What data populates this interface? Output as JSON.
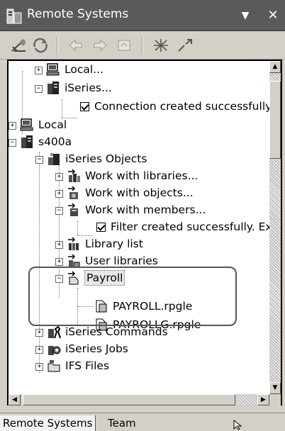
{
  "window": {
    "title": "Remote Systems"
  },
  "toolbar": {
    "buttons": [
      "new-connection-icon",
      "refresh-icon",
      "back-icon",
      "forward-icon",
      "home-icon",
      "collapse-all-icon",
      "link-with-editor-icon"
    ]
  },
  "tree": {
    "local1": "Local...",
    "iseries1": "iSeries...",
    "connection_msg": "Connection created successfully.",
    "local2": "Local",
    "s400a": "s400a",
    "iseries_objects": "iSeries Objects",
    "work_libraries": "Work with libraries...",
    "work_objects": "Work with objects...",
    "work_members": "Work with members...",
    "filter_msg": "Filter created successfully. Exp",
    "library_list": "Library list",
    "user_libraries": "User libraries",
    "payroll": "Payroll",
    "payroll_file": "PAYROLL.rpgle",
    "payrollg_file": "PAYROLLG.rpgle",
    "iseries_commands": "iSeries Commands",
    "iseries_jobs": "iSeries Jobs",
    "ifs_files": "IFS Files"
  },
  "tabs": {
    "remote": "Remote Systems",
    "team": "Team"
  }
}
